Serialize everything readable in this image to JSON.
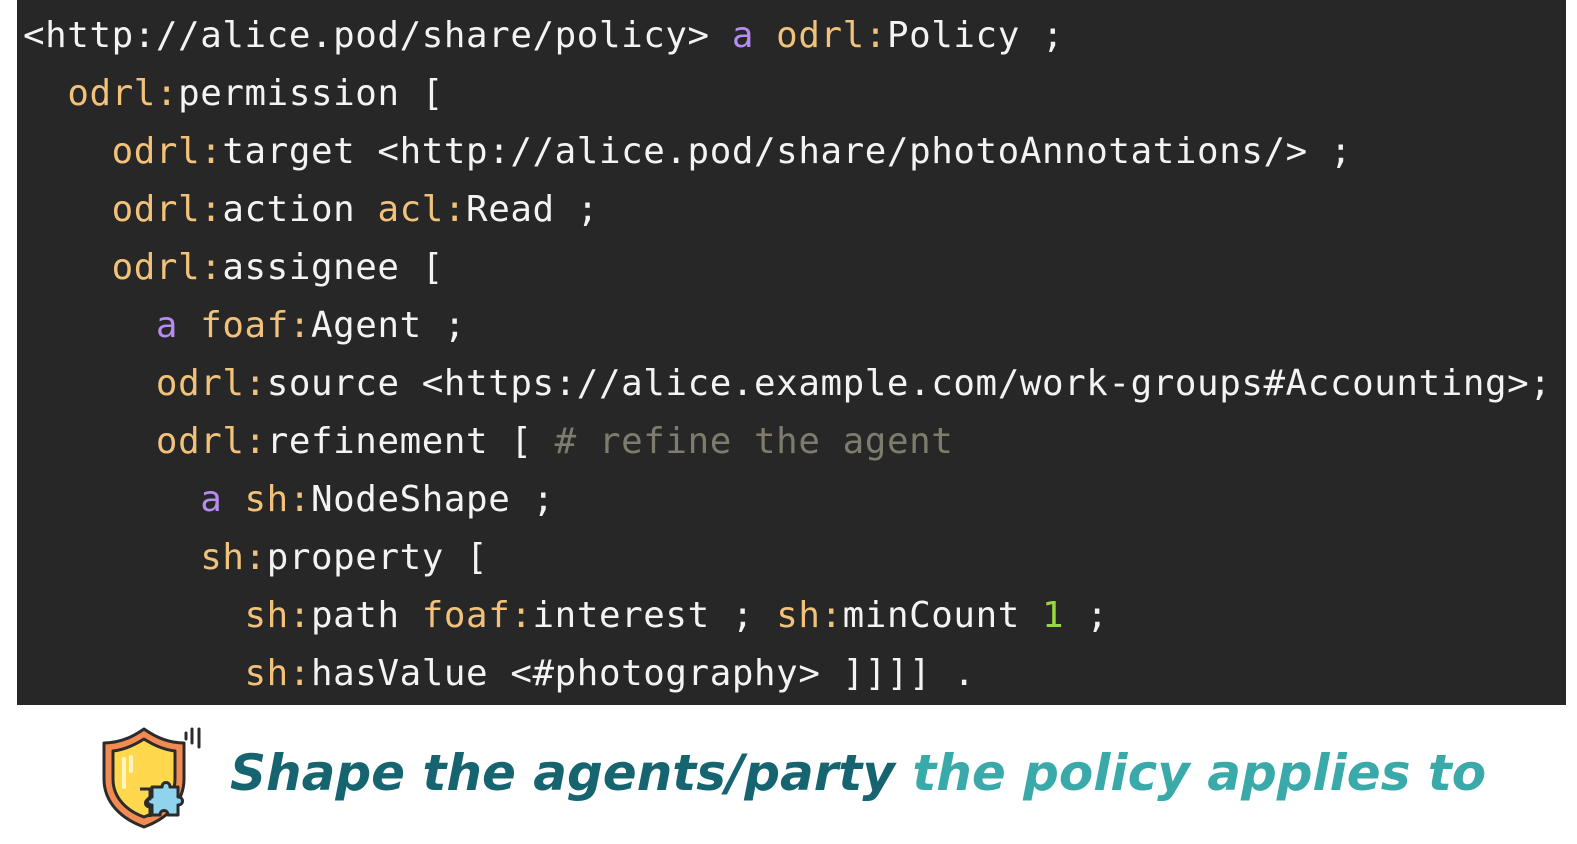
{
  "code": {
    "language": "turtle",
    "colors": {
      "background": "#272727",
      "text": "#f3f3f3",
      "prefix": "#f2c27b",
      "keyword": "#b58cf0",
      "number": "#9ad63d",
      "comment": "#7e7d6d"
    },
    "lines": [
      {
        "indent": "",
        "tokens": [
          {
            "type": "text",
            "text": "<http://alice.pod/share/policy> "
          },
          {
            "type": "keyword",
            "text": "a"
          },
          {
            "type": "text",
            "text": " "
          },
          {
            "type": "prefix",
            "text": "odrl:"
          },
          {
            "type": "text",
            "text": "Policy ;"
          }
        ]
      },
      {
        "indent": "  ",
        "tokens": [
          {
            "type": "prefix",
            "text": "odrl:"
          },
          {
            "type": "text",
            "text": "permission ["
          }
        ]
      },
      {
        "indent": "    ",
        "tokens": [
          {
            "type": "prefix",
            "text": "odrl:"
          },
          {
            "type": "text",
            "text": "target <http://alice.pod/share/photoAnnotations/> ;"
          }
        ]
      },
      {
        "indent": "    ",
        "tokens": [
          {
            "type": "prefix",
            "text": "odrl:"
          },
          {
            "type": "text",
            "text": "action "
          },
          {
            "type": "prefix",
            "text": "acl:"
          },
          {
            "type": "text",
            "text": "Read ;"
          }
        ]
      },
      {
        "indent": "    ",
        "tokens": [
          {
            "type": "prefix",
            "text": "odrl:"
          },
          {
            "type": "text",
            "text": "assignee ["
          }
        ]
      },
      {
        "indent": "      ",
        "tokens": [
          {
            "type": "keyword",
            "text": "a"
          },
          {
            "type": "text",
            "text": " "
          },
          {
            "type": "prefix",
            "text": "foaf:"
          },
          {
            "type": "text",
            "text": "Agent ;"
          }
        ]
      },
      {
        "indent": "      ",
        "tokens": [
          {
            "type": "prefix",
            "text": "odrl:"
          },
          {
            "type": "text",
            "text": "source <https://alice.example.com/work-groups#Accounting>;"
          }
        ]
      },
      {
        "indent": "      ",
        "tokens": [
          {
            "type": "prefix",
            "text": "odrl:"
          },
          {
            "type": "text",
            "text": "refinement [ "
          },
          {
            "type": "comment",
            "text": "# refine the agent"
          }
        ]
      },
      {
        "indent": "        ",
        "tokens": [
          {
            "type": "keyword",
            "text": "a"
          },
          {
            "type": "text",
            "text": " "
          },
          {
            "type": "prefix",
            "text": "sh:"
          },
          {
            "type": "text",
            "text": "NodeShape ;"
          }
        ]
      },
      {
        "indent": "        ",
        "tokens": [
          {
            "type": "prefix",
            "text": "sh:"
          },
          {
            "type": "text",
            "text": "property ["
          }
        ]
      },
      {
        "indent": "          ",
        "tokens": [
          {
            "type": "prefix",
            "text": "sh:"
          },
          {
            "type": "text",
            "text": "path "
          },
          {
            "type": "prefix",
            "text": "foaf:"
          },
          {
            "type": "text",
            "text": "interest ; "
          },
          {
            "type": "prefix",
            "text": "sh:"
          },
          {
            "type": "text",
            "text": "minCount "
          },
          {
            "type": "number",
            "text": "1"
          },
          {
            "type": "text",
            "text": " ;"
          }
        ]
      },
      {
        "indent": "          ",
        "tokens": [
          {
            "type": "prefix",
            "text": "sh:"
          },
          {
            "type": "text",
            "text": "hasValue <#photography> ]]]] ."
          }
        ]
      }
    ]
  },
  "caption": {
    "icon": "shield-puzzle-icon",
    "strong": "Shape the agents/party",
    "light": " the policy applies to",
    "colors": {
      "strong": "#166470",
      "light": "#3aa9a9"
    }
  }
}
